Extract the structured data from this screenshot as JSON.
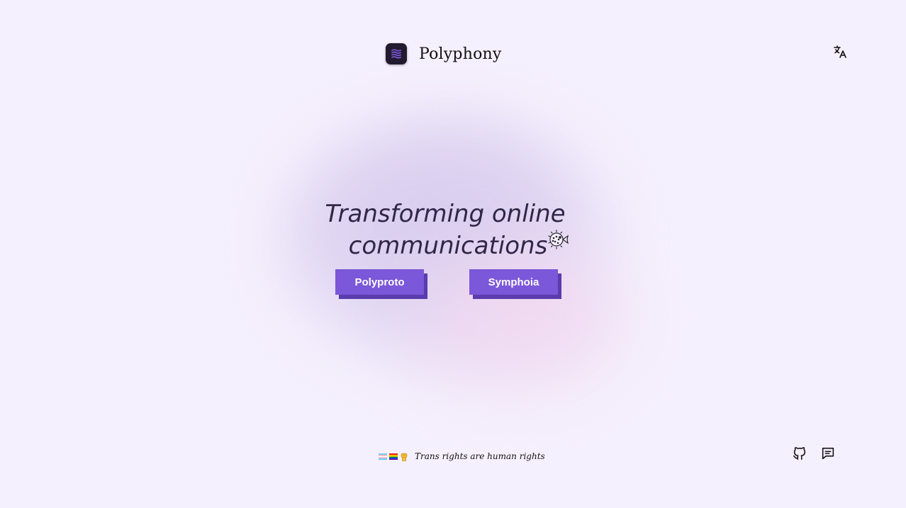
{
  "brand": {
    "name": "Polyphony",
    "logo_icon": "polyphony-logo",
    "logo_bg": "#221a2e",
    "logo_accent": "#7b57d9"
  },
  "header": {
    "language_icon": "translate-icon"
  },
  "hero": {
    "title_line1": "Transforming online",
    "title_line2": "communications",
    "decoration_icon": "pufferfish-icon"
  },
  "cta": {
    "primary_label": "Polyproto",
    "secondary_label": "Symphoia",
    "color": "#7b57d9",
    "shadow_color": "#5a3cae"
  },
  "footer": {
    "note": "Trans rights are human rights",
    "note_icons": [
      "transgender-flag-icon",
      "pride-flag-icon",
      "raised-fist-icon"
    ],
    "links": [
      {
        "icon": "github-icon"
      },
      {
        "icon": "chat-icon"
      }
    ]
  },
  "colors": {
    "background": "#f5f0fd",
    "text": "#231a3a"
  }
}
